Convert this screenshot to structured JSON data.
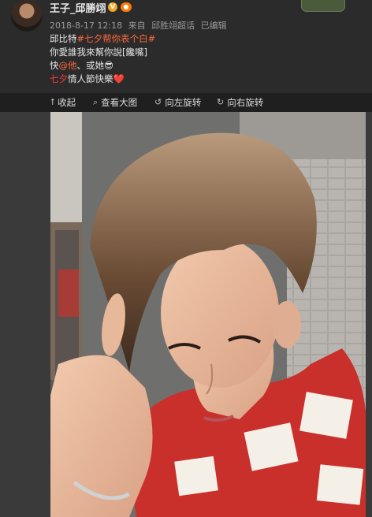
{
  "post": {
    "username": "王子_邱勝翊",
    "v_badge": "V",
    "level_badge": "〷",
    "date": "2018-8-17 12:18",
    "source_prefix": "来自",
    "source": "邱胜翊超话",
    "edited": "已编辑",
    "lines": {
      "l1_a": "邱比特",
      "l1_topic": "#七夕帮你表个白#",
      "l2": "你愛誰我來幫你說[饞嘴]",
      "l3_a": "快",
      "l3_mention": "@他",
      "l3_b": "、或她😎",
      "l4_a": "七夕",
      "l4_b": "情人節快樂❤️"
    }
  },
  "toolbar": {
    "collapse": "收起",
    "view_large": "查看大图",
    "rotate_left": "向左旋转",
    "rotate_right": "向右旋转"
  },
  "icons": {
    "collapse": "arrow-up-icon",
    "view_large": "magnifier-icon",
    "rotate_left": "rotate-left-icon",
    "rotate_right": "rotate-right-icon"
  },
  "colors": {
    "topic": "#ff6a3c",
    "red_text": "#ff3b3b",
    "background": "#2b2b2b",
    "toolbar": "#1f1f1f"
  }
}
